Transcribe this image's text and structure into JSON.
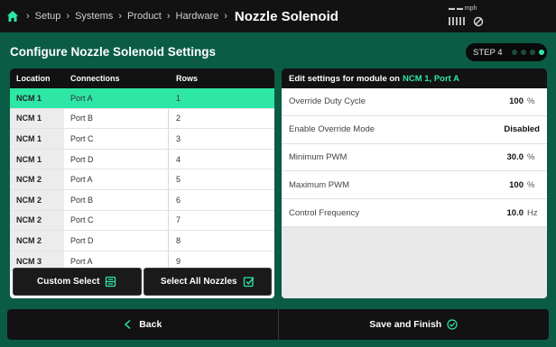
{
  "breadcrumb": {
    "items": [
      "Setup",
      "Systems",
      "Product",
      "Hardware"
    ],
    "current": "Nozzle Solenoid"
  },
  "status": {
    "speed_unit": "mph"
  },
  "page": {
    "title": "Configure Nozzle Solenoid Settings"
  },
  "step": {
    "label": "STEP 4",
    "total": 4,
    "current": 1
  },
  "table": {
    "headers": {
      "location": "Location",
      "connections": "Connections",
      "rows": "Rows"
    },
    "rows": [
      {
        "location": "NCM 1",
        "connection": "Port A",
        "row": "1",
        "selected": true
      },
      {
        "location": "NCM 1",
        "connection": "Port B",
        "row": "2"
      },
      {
        "location": "NCM 1",
        "connection": "Port C",
        "row": "3"
      },
      {
        "location": "NCM 1",
        "connection": "Port D",
        "row": "4"
      },
      {
        "location": "NCM 2",
        "connection": "Port A",
        "row": "5"
      },
      {
        "location": "NCM 2",
        "connection": "Port B",
        "row": "6"
      },
      {
        "location": "NCM 2",
        "connection": "Port C",
        "row": "7"
      },
      {
        "location": "NCM 2",
        "connection": "Port D",
        "row": "8"
      },
      {
        "location": "NCM 3",
        "connection": "Port A",
        "row": "9"
      }
    ],
    "custom_select_label": "Custom Select",
    "select_all_label": "Select All Nozzles"
  },
  "settings": {
    "heading_prefix": "Edit settings for module on",
    "heading_module": "NCM 1, Port A",
    "items": [
      {
        "label": "Override Duty Cycle",
        "value": "100",
        "unit": "%"
      },
      {
        "label": "Enable Override Mode",
        "value": "Disabled",
        "unit": ""
      },
      {
        "label": "Minimum PWM",
        "value": "30.0",
        "unit": "%"
      },
      {
        "label": "Maximum PWM",
        "value": "100",
        "unit": "%"
      },
      {
        "label": "Control Frequency",
        "value": "10.0",
        "unit": "Hz"
      }
    ]
  },
  "footer": {
    "back_label": "Back",
    "save_label": "Save and Finish"
  },
  "colors": {
    "accent": "#2ee6a6",
    "background": "#0b5c45",
    "panel_dark": "#121212"
  }
}
